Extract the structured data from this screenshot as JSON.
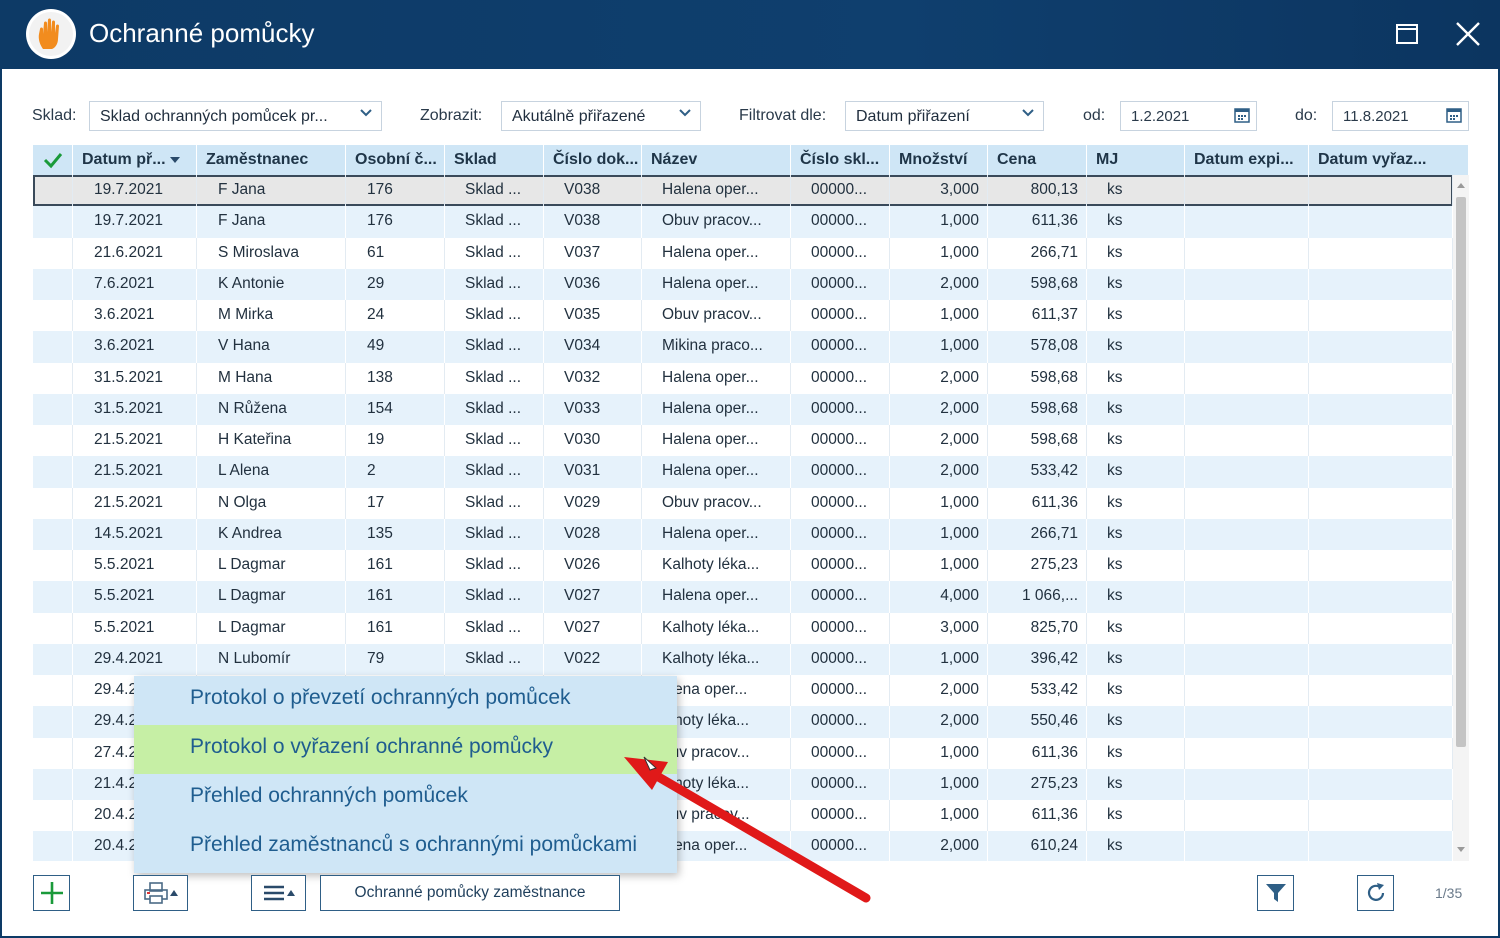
{
  "window": {
    "title": "Ochranné pomůcky"
  },
  "filters": {
    "sklad_label": "Sklad:",
    "sklad_value": "Sklad ochranných pomůcek pr...",
    "zobrazit_label": "Zobrazit:",
    "zobrazit_value": "Akutálně přiřazené",
    "filtrovat_label": "Filtrovat dle:",
    "filtrovat_value": "Datum přiřazení",
    "od_label": "od:",
    "od_value": "1.2.2021",
    "do_label": "do:",
    "do_value": "11.8.2021"
  },
  "grid": {
    "columns": [
      "Datum př...",
      "Zaměstnanec",
      "Osobní č...",
      "Sklad",
      "Číslo dok...",
      "Název",
      "Číslo skl...",
      "Množství",
      "Cena",
      "MJ",
      "Datum expi...",
      "Datum vyřaz..."
    ],
    "rows": [
      [
        "19.7.2021",
        "F Jana",
        "176",
        "Sklad ...",
        "V038",
        "Halena oper...",
        "00000...",
        "3,000",
        "800,13",
        "ks"
      ],
      [
        "19.7.2021",
        "F Jana",
        "176",
        "Sklad ...",
        "V038",
        "Obuv pracov...",
        "00000...",
        "1,000",
        "611,36",
        "ks"
      ],
      [
        "21.6.2021",
        "S Miroslava",
        "61",
        "Sklad ...",
        "V037",
        "Halena oper...",
        "00000...",
        "1,000",
        "266,71",
        "ks"
      ],
      [
        "7.6.2021",
        "K Antonie",
        "29",
        "Sklad ...",
        "V036",
        "Halena oper...",
        "00000...",
        "2,000",
        "598,68",
        "ks"
      ],
      [
        "3.6.2021",
        "M Mirka",
        "24",
        "Sklad ...",
        "V035",
        "Obuv pracov...",
        "00000...",
        "1,000",
        "611,37",
        "ks"
      ],
      [
        "3.6.2021",
        "V Hana",
        "49",
        "Sklad ...",
        "V034",
        "Mikina praco...",
        "00000...",
        "1,000",
        "578,08",
        "ks"
      ],
      [
        "31.5.2021",
        "M Hana",
        "138",
        "Sklad ...",
        "V032",
        "Halena oper...",
        "00000...",
        "2,000",
        "598,68",
        "ks"
      ],
      [
        "31.5.2021",
        "N Růžena",
        "154",
        "Sklad ...",
        "V033",
        "Halena oper...",
        "00000...",
        "2,000",
        "598,68",
        "ks"
      ],
      [
        "21.5.2021",
        "H Kateřina",
        "19",
        "Sklad ...",
        "V030",
        "Halena oper...",
        "00000...",
        "2,000",
        "598,68",
        "ks"
      ],
      [
        "21.5.2021",
        "L Alena",
        "2",
        "Sklad ...",
        "V031",
        "Halena oper...",
        "00000...",
        "2,000",
        "533,42",
        "ks"
      ],
      [
        "21.5.2021",
        "N Olga",
        "17",
        "Sklad ...",
        "V029",
        "Obuv pracov...",
        "00000...",
        "1,000",
        "611,36",
        "ks"
      ],
      [
        "14.5.2021",
        "K Andrea",
        "135",
        "Sklad ...",
        "V028",
        "Halena oper...",
        "00000...",
        "1,000",
        "266,71",
        "ks"
      ],
      [
        "5.5.2021",
        "L Dagmar",
        "161",
        "Sklad ...",
        "V026",
        "Kalhoty léka...",
        "00000...",
        "1,000",
        "275,23",
        "ks"
      ],
      [
        "5.5.2021",
        "L Dagmar",
        "161",
        "Sklad ...",
        "V027",
        "Halena oper...",
        "00000...",
        "4,000",
        "1 066,...",
        "ks"
      ],
      [
        "5.5.2021",
        "L Dagmar",
        "161",
        "Sklad ...",
        "V027",
        "Kalhoty léka...",
        "00000...",
        "3,000",
        "825,70",
        "ks"
      ],
      [
        "29.4.2021",
        "N Lubomír",
        "79",
        "Sklad ...",
        "V022",
        "Kalhoty léka...",
        "00000...",
        "1,000",
        "396,42",
        "ks"
      ],
      [
        "29.4.2",
        "",
        "",
        "",
        "",
        "alena oper...",
        "00000...",
        "2,000",
        "533,42",
        "ks"
      ],
      [
        "29.4.2",
        "",
        "",
        "",
        "",
        "alhoty léka...",
        "00000...",
        "2,000",
        "550,46",
        "ks"
      ],
      [
        "27.4.2",
        "",
        "",
        "",
        "",
        "buv pracov...",
        "00000...",
        "1,000",
        "611,36",
        "ks"
      ],
      [
        "21.4.2",
        "",
        "",
        "",
        "",
        "alhoty léka...",
        "00000...",
        "1,000",
        "275,23",
        "ks"
      ],
      [
        "20.4.2",
        "",
        "",
        "",
        "",
        "buv pracov...",
        "00000...",
        "1,000",
        "611,36",
        "ks"
      ],
      [
        "20.4.2",
        "",
        "",
        "",
        "",
        "alena oper...",
        "00000...",
        "2,000",
        "610,24",
        "ks"
      ]
    ]
  },
  "popup_menu": {
    "items": [
      "Protokol o převzetí ochranných pomůcek",
      "Protokol o vyřazení ochranné pomůcky",
      "Přehled ochranných pomůcek",
      "Přehled zaměstnanců s ochrannými pomůckami"
    ],
    "hovered_index": 1
  },
  "toolbar": {
    "employee_button_label": "Ochranné pomůcky zaměstnance",
    "pager": "1/35",
    "icons": [
      "add-icon",
      "print-icon",
      "menu-icon",
      "filter-icon",
      "refresh-icon"
    ]
  },
  "colors": {
    "titlebar": "#0d3a66",
    "header_bg": "#cfe6f6",
    "row_alt": "#e6f2fb",
    "menu_hover": "#c6efa5",
    "arrow": "#e01919",
    "accent_green": "#1a9a3a"
  }
}
